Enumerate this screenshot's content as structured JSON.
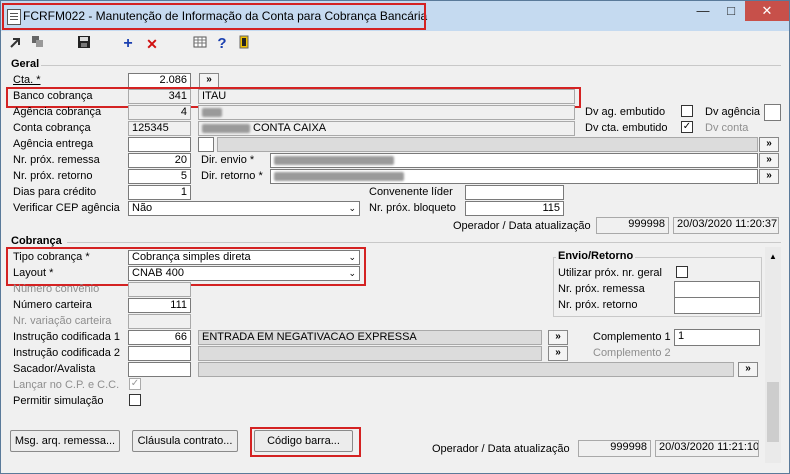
{
  "window": {
    "title": "FCRFM022 - Manutenção de Informação da Conta para Cobrança Bancária",
    "minimize": "—",
    "maximize": "□",
    "close": "✕"
  },
  "toolbar": {
    "plus": "+",
    "delete": "✕",
    "help": "?"
  },
  "geral": {
    "title": "Geral",
    "cta_label": "Cta. *",
    "cta_value": "2.086",
    "cta_btn": "»",
    "banco_label": "Banco cobrança",
    "banco_code": "341",
    "banco_name": "ITAU",
    "agencia_label": "Agência cobrança",
    "agencia_code": "4",
    "conta_label": "Conta cobrança",
    "conta_code": "125345",
    "conta_name": "CONTA CAIXA",
    "entrega_label": "Agência entrega",
    "remessa_label": "Nr. próx. remessa",
    "remessa_value": "20",
    "retorno_label": "Nr. próx. retorno",
    "retorno_value": "5",
    "dias_label": "Dias para crédito",
    "dias_value": "1",
    "cep_label": "Verificar CEP agência",
    "cep_value": "Não",
    "dir_envio_label": "Dir. envio *",
    "dir_retorno_label": "Dir. retorno *",
    "dv_ag_emb_label": "Dv ag. embutido",
    "dv_agencia_label": "Dv agência",
    "dv_cta_emb_label": "Dv cta. embutido",
    "dv_conta_label": "Dv conta",
    "conv_lider_label": "Convenente líder",
    "bloqueto_label": "Nr. próx. bloqueto",
    "bloqueto_value": "115",
    "op_label": "Operador / Data atualização",
    "op_value": "999998",
    "date_value": "20/03/2020 11:20:37"
  },
  "cobranca": {
    "title": "Cobrança",
    "tipo_label": "Tipo cobrança *",
    "tipo_value": "Cobrança simples direta",
    "layout_label": "Layout *",
    "layout_value": "CNAB 400",
    "convenio_label": "Número convênio",
    "carteira_label": "Número carteira",
    "carteira_value": "111",
    "variacao_label": "Nr. variação carteira",
    "instr1_label": "Instrução codificada 1",
    "instr1_value": "66",
    "instr1_desc": "ENTRADA EM NEGATIVACAO EXPRESSA",
    "instr2_label": "Instrução codificada 2",
    "sacador_label": "Sacador/Avalista",
    "lancar_label": "Lançar no C.P. e C.C.",
    "simulacao_label": "Permitir simulação",
    "compl1_label": "Complemento 1",
    "compl1_value": "1",
    "compl2_label": "Complemento 2",
    "envio_title": "Envio/Retorno",
    "utilizar_label": "Utilizar próx. nr. geral",
    "env_remessa_label": "Nr. próx. remessa",
    "env_retorno_label": "Nr. próx. retorno",
    "op_label": "Operador / Data atualização",
    "op_value": "999998",
    "date_value": "20/03/2020 11:21:10"
  },
  "buttons": {
    "msg": "Msg. arq. remessa...",
    "clausula": "Cláusula contrato...",
    "codigo": "Código barra..."
  }
}
